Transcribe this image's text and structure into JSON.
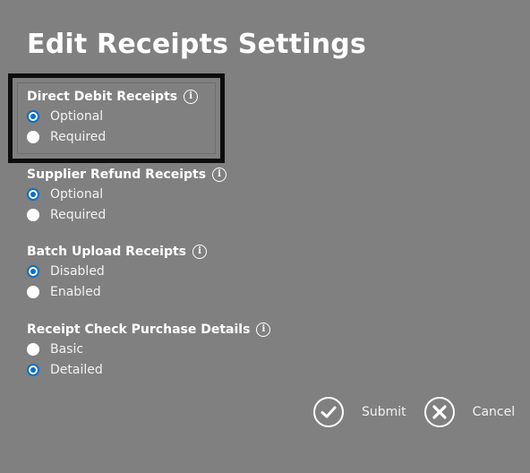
{
  "title": "Edit Receipts Settings",
  "groups": [
    {
      "label": "Direct Debit Receipts",
      "options": [
        {
          "label": "Optional",
          "checked": true
        },
        {
          "label": "Required",
          "checked": false
        }
      ]
    },
    {
      "label": "Supplier Refund Receipts",
      "options": [
        {
          "label": "Optional",
          "checked": true
        },
        {
          "label": "Required",
          "checked": false
        }
      ]
    },
    {
      "label": "Batch Upload Receipts",
      "options": [
        {
          "label": "Disabled",
          "checked": true
        },
        {
          "label": "Enabled",
          "checked": false
        }
      ]
    },
    {
      "label": "Receipt Check Purchase Details",
      "options": [
        {
          "label": "Basic",
          "checked": false
        },
        {
          "label": "Detailed",
          "checked": true
        }
      ]
    }
  ],
  "info_icon_glyph": "i",
  "actions": {
    "submit_label": "Submit",
    "cancel_label": "Cancel"
  },
  "colors": {
    "background": "#808080",
    "radio_accent": "#0a6ec8",
    "highlight_border": "#0d0d0d"
  }
}
